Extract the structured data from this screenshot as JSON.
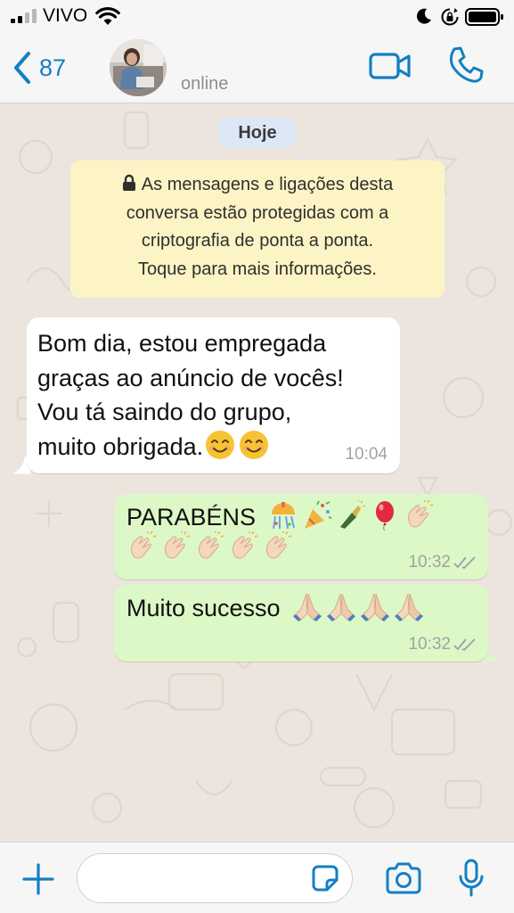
{
  "status_bar": {
    "carrier": "VIVO",
    "icons": [
      "signal-icon",
      "wifi-icon",
      "moon-icon",
      "orientation-lock-icon",
      "battery-icon"
    ]
  },
  "header": {
    "back_count": "87",
    "presence": "online",
    "icons": [
      "chevron-left-icon",
      "avatar",
      "video-camera-icon",
      "phone-icon"
    ]
  },
  "chat": {
    "date_chip": "Hoje",
    "encryption_notice": {
      "line1": "As mensagens e ligações desta",
      "line2": "conversa estão protegidas com a",
      "line3": "criptografia de ponta a ponta.",
      "line4": "Toque para mais informações."
    },
    "messages": [
      {
        "direction": "incoming",
        "lines": [
          "Bom dia, estou empregada",
          "graças ao anúncio de vocês!",
          "Vou tá saindo do grupo,",
          "muito obrigada."
        ],
        "emojis": [
          "smiling-face-emoji",
          "smiling-face-emoji"
        ],
        "time": "10:04"
      },
      {
        "direction": "outgoing",
        "text": "PARABÉNS",
        "emojis_line1": [
          "confetti-ball-emoji",
          "party-popper-emoji",
          "champagne-emoji",
          "balloon-emoji",
          "clapping-hands-emoji"
        ],
        "emojis_line2": [
          "clapping-hands-emoji",
          "clapping-hands-emoji",
          "clapping-hands-emoji",
          "clapping-hands-emoji",
          "clapping-hands-emoji"
        ],
        "time": "10:32",
        "status": "read"
      },
      {
        "direction": "outgoing",
        "text": "Muito sucesso",
        "emojis": [
          "folded-hands-emoji",
          "folded-hands-emoji",
          "folded-hands-emoji",
          "folded-hands-emoji"
        ],
        "time": "10:32",
        "status": "read"
      }
    ]
  },
  "input_bar": {
    "message_value": "",
    "icons": [
      "plus-icon",
      "sticker-icon",
      "camera-icon",
      "microphone-icon"
    ]
  },
  "colors": {
    "accent": "#1380c3",
    "wallpaper": "#ece5dd",
    "incoming_bubble": "#ffffff",
    "outgoing_bubble": "#dcf8c6",
    "date_chip": "#dde8f6",
    "notice": "#fdf4c5",
    "read_ticks": "#9aa0a6"
  }
}
